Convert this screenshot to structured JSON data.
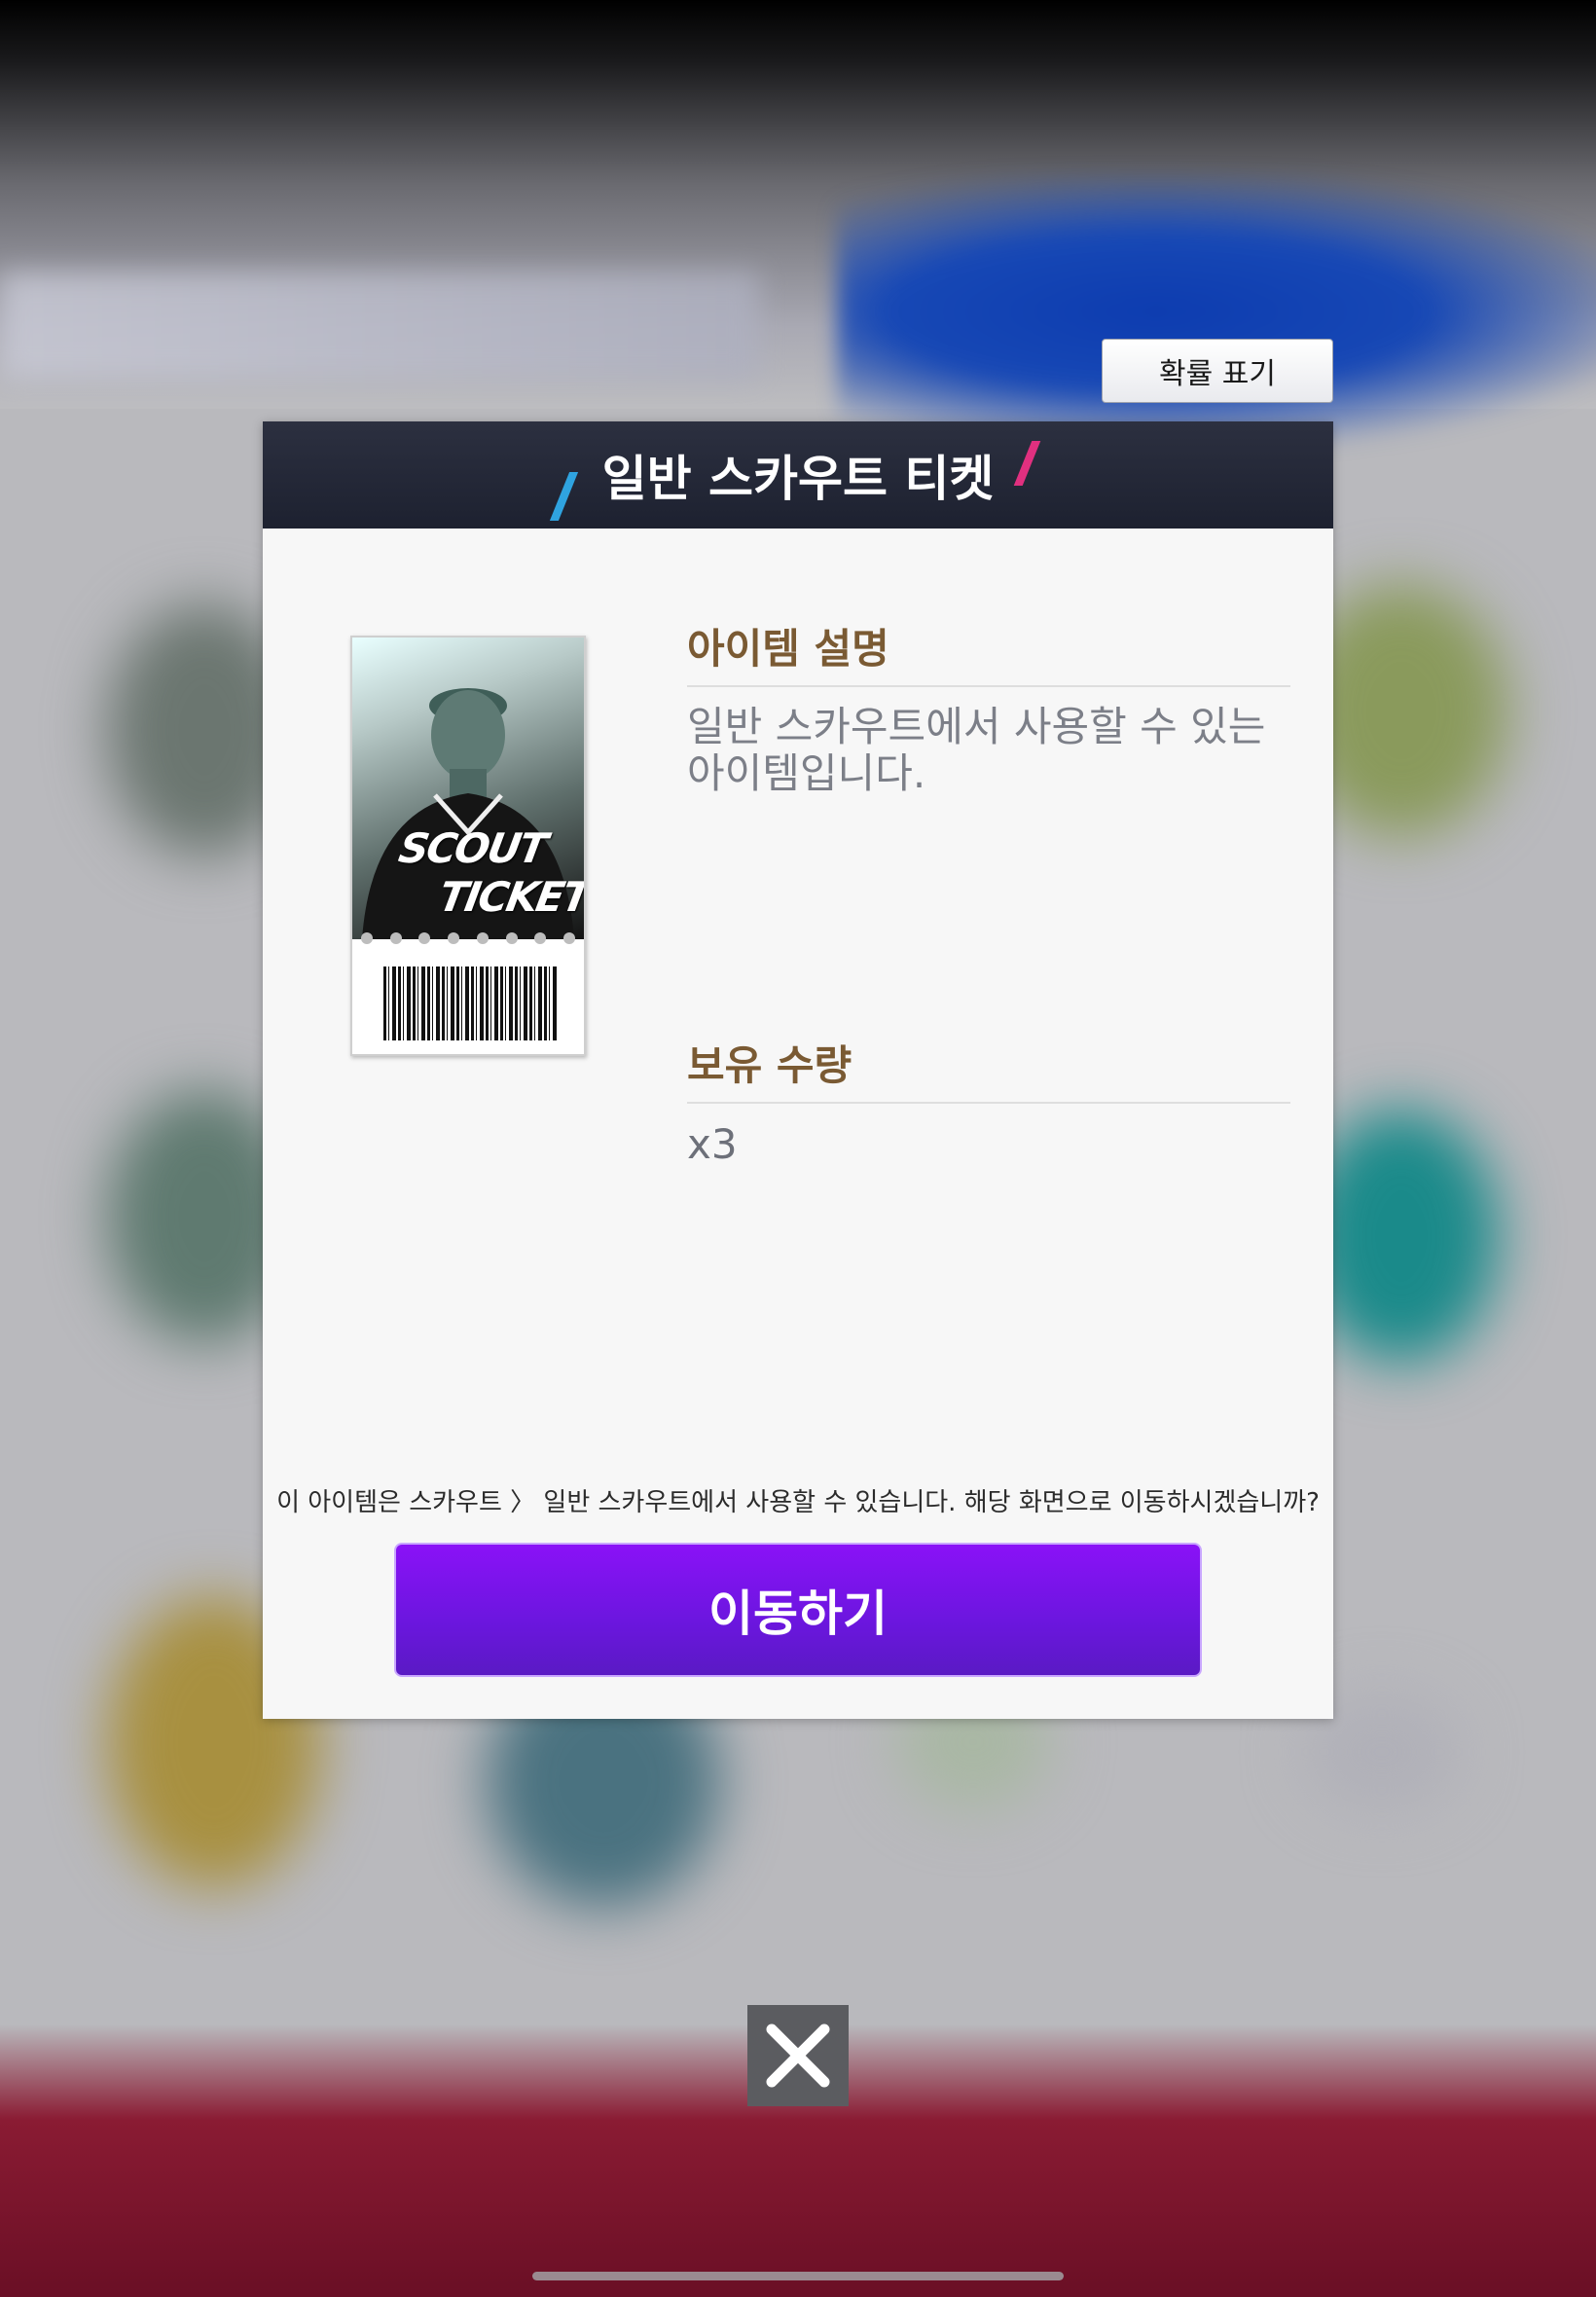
{
  "probability_button": {
    "label": "확률 표기"
  },
  "dialog": {
    "title": "일반 스카우트 티켓",
    "item_image": {
      "line1": "SCOUT",
      "line2": "TICKET"
    },
    "description_section": {
      "title": "아이템 설명",
      "text_line1": "일반 스카우트에서 사용할 수 있는",
      "text_line2": "아이템입니다."
    },
    "quantity_section": {
      "title": "보유 수량",
      "value": "x3"
    },
    "notice": "이 아이템은 스카우트 〉 일반 스카우트에서 사용할 수 있습니다. 해당 화면으로 이동하시겠습니까?",
    "go_button": "이동하기"
  },
  "close_button": {
    "icon": "close-icon"
  },
  "colors": {
    "header_bg": "#1d2130",
    "accent_blue": "#2fa3e0",
    "accent_pink": "#e0307f",
    "section_title": "#7a5a33",
    "go_button": "#7a14ea"
  }
}
